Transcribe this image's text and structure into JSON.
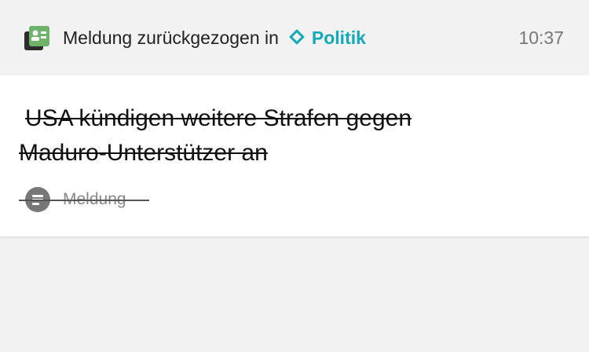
{
  "header": {
    "notice_text": "Meldung zurückgezogen in",
    "category": "Politik",
    "time": "10:37",
    "category_color": "#14a8b8",
    "app_icon": "news-app-icon"
  },
  "article": {
    "title": "USA kündigen weitere Strafen gegen Maduro-Unterstützer an",
    "type_label": "Meldung",
    "type_icon": "text-lines-icon"
  }
}
